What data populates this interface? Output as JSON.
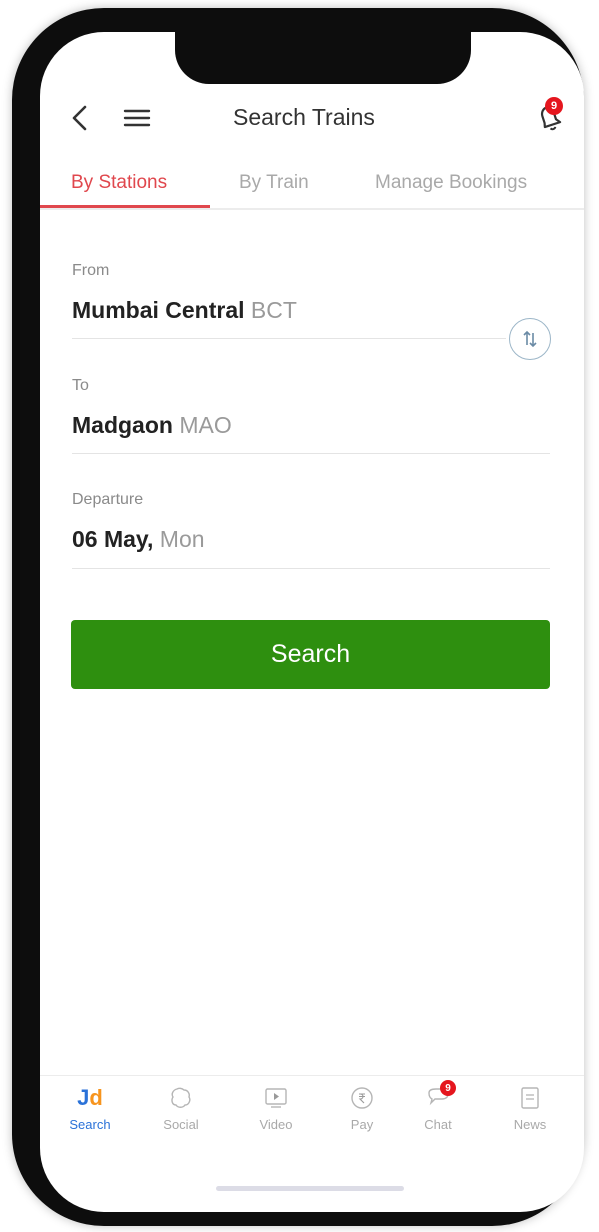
{
  "header": {
    "title": "Search Trains",
    "notification_count": "9"
  },
  "tabs": [
    {
      "label": "By Stations",
      "active": true
    },
    {
      "label": "By Train",
      "active": false
    },
    {
      "label": "Manage Bookings",
      "active": false
    }
  ],
  "form": {
    "from": {
      "label": "From",
      "station": "Mumbai Central",
      "code": "BCT"
    },
    "to": {
      "label": "To",
      "station": "Madgaon",
      "code": "MAO"
    },
    "departure": {
      "label": "Departure",
      "date": "06 May,",
      "day": "Mon"
    }
  },
  "search_button": {
    "label": "Search"
  },
  "bottom_nav": [
    {
      "label": "Search",
      "icon": "jd-logo-icon",
      "active": true
    },
    {
      "label": "Social",
      "icon": "social-icon"
    },
    {
      "label": "Video",
      "icon": "video-icon"
    },
    {
      "label": "Pay",
      "icon": "rupee-pay-icon"
    },
    {
      "label": "Chat",
      "icon": "chat-icon",
      "badge": "9"
    },
    {
      "label": "News",
      "icon": "news-icon"
    }
  ],
  "logo_text": {
    "j": "J",
    "d": "d"
  },
  "colors": {
    "accent_red": "#e0474d",
    "search_green": "#2e8f0f",
    "nav_active_blue": "#2b72d8",
    "badge_red": "#e5161e"
  }
}
